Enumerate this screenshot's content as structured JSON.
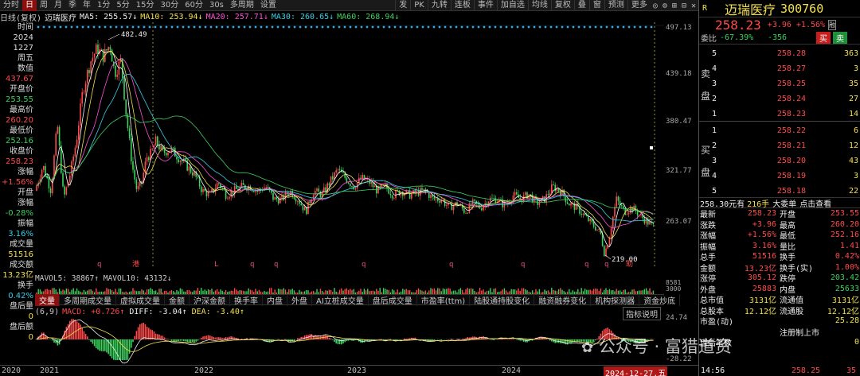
{
  "toolbar": {
    "items": [
      "分时",
      "日",
      "周",
      "月",
      "季",
      "年",
      "1分",
      "5分",
      "15分",
      "30分",
      "60分",
      "30s",
      "多周期",
      "设置"
    ],
    "active_index": 1,
    "right_items": [
      "发",
      "PK",
      "九转",
      "连板",
      "事件",
      "加自选",
      "均线",
      "复权",
      "叠",
      "窗",
      "预测",
      "更多"
    ]
  },
  "subhead": {
    "label": "日线(复权)",
    "name": "迈瑞医疗",
    "ma5": "MA5: 255.57↓",
    "ma10": "MA10: 253.94↓",
    "ma20": "MA20: 257.71↓",
    "ma30": "MA30: 260.65↓",
    "ma60": "MA60: 268.94↓"
  },
  "leftcol": [
    "时间",
    "2024",
    "1227",
    "周五",
    "数值",
    "437.67",
    "开盘价",
    "253.55",
    "最高价",
    "260.20",
    "最低价",
    "252.16",
    "收盘价",
    "258.23",
    "涨幅",
    "+1.56%",
    "开盘",
    "涨幅",
    "-0.28%",
    "振幅",
    "3.16%",
    "成交量",
    "51516",
    "成交额",
    "13.23亿",
    "换手",
    "0.42%",
    "盘后量",
    "0",
    "盘后额",
    "0"
  ],
  "chart": {
    "yticks": [
      "497.13",
      "439.18",
      "380.47",
      "321.77",
      "263.07"
    ],
    "annotations": {
      "high": "482.49",
      "low": "219.00"
    },
    "markers": [
      "q",
      "L",
      "q",
      "q",
      "q",
      "q",
      "q",
      "q",
      "q",
      "q"
    ],
    "special_marker": "港",
    "marker_bottom_right": "助",
    "macd_yticks": [
      "24.74",
      "-28.22"
    ]
  },
  "volume": {
    "label": "MAVOL5: 38867↑  MAVOL10: 43132↓",
    "right_values": [
      "8581",
      "3000"
    ]
  },
  "macd": {
    "label": "(6,9)",
    "macd": "MACD: +0.726↑",
    "diff": "DIFF: -3.04↑",
    "dea": "DEA: -3.40↑",
    "button": "指标说明"
  },
  "tabs": [
    "交量",
    "多周期成交量",
    "虚拟成交量",
    "金额",
    "沪深金额",
    "换手率",
    "内盘",
    "外盘",
    "AI立桩成交量",
    "盘后成交量",
    "市盈率(ttm)",
    "陆股通持股变化",
    "融资融券变化",
    "机构探测器",
    "资金炒底"
  ],
  "tabs_active_index": 0,
  "xaxis": [
    "2020",
    "2021",
    "2022",
    "2023",
    "2024",
    "2024-12-27,五"
  ],
  "right": {
    "badge": "R",
    "stock_name": "迈瑞医疗",
    "stock_code": "300760",
    "price": "258.23",
    "chg": "+3.96",
    "chgpct": "+1.56%",
    "flag": "融",
    "weibi_label": "委比",
    "weibi": "-67.39%",
    "weicha": "-356",
    "buy_btn": "买",
    "sell_btn": "卖",
    "sell_label": [
      "卖",
      "盘"
    ],
    "buy_label": [
      "买",
      "盘"
    ],
    "asks": [
      {
        "lvl": "5",
        "price": "258.28",
        "vol": "363"
      },
      {
        "lvl": "4",
        "price": "258.27",
        "vol": "3"
      },
      {
        "lvl": "3",
        "price": "258.25",
        "vol": "35"
      },
      {
        "lvl": "2",
        "price": "258.24",
        "vol": "27"
      },
      {
        "lvl": "1",
        "price": "258.23",
        "vol": "14"
      }
    ],
    "bids": [
      {
        "lvl": "1",
        "price": "258.22",
        "vol": "6"
      },
      {
        "lvl": "2",
        "price": "258.21",
        "vol": "12"
      },
      {
        "lvl": "3",
        "price": "258.20",
        "vol": "43"
      },
      {
        "lvl": "4",
        "price": "258.19",
        "vol": "3"
      },
      {
        "lvl": "5",
        "price": "258.18",
        "vol": "22"
      }
    ],
    "bigorder": {
      "price": "258.30元有",
      "hands": "216手",
      "big": "大委单",
      "check": "点击查看"
    },
    "stats": [
      {
        "l1": "最新",
        "v1": "258.23",
        "l2": "开盘",
        "v2": "253.55"
      },
      {
        "l1": "涨跌",
        "v1": "+3.96",
        "l2": "最高",
        "v2": "260.20"
      },
      {
        "l1": "涨幅",
        "v1": "+1.56%",
        "l2": "最低",
        "v2": "252.16"
      },
      {
        "l1": "振幅",
        "v1": "3.16%",
        "l2": "量比",
        "v2": "1.41"
      },
      {
        "l1": "总手",
        "v1": "51516",
        "l2": "换手",
        "v2": "0.42%"
      },
      {
        "l1": "金额",
        "v1": "13.23亿",
        "l2": "换手(实)",
        "v2": "1.00%"
      },
      {
        "l1": "涨停",
        "v1": "305.12",
        "l2": "跌停",
        "v2": "203.42"
      },
      {
        "l1": "外盘",
        "v1": "25883",
        "l2": "内盘",
        "v2": "25633"
      },
      {
        "l1": "总市值",
        "v1": "3131亿",
        "l2": "流通值",
        "v2": "3131亿"
      },
      {
        "l1": "总股本",
        "v1": "12.12亿",
        "l2": "流通股",
        "v2": "12.12亿"
      },
      {
        "l1": "市盈(动)",
        "v1": "",
        "l2": "",
        "v2": "25.28"
      },
      {
        "l1": "",
        "v1": "",
        "l2": "注册制上市",
        "v2": ""
      },
      {
        "l1": "盘后笔数",
        "v1": "",
        "l2": "",
        "v2": "0"
      }
    ],
    "bottom": {
      "time": "14:56",
      "price": "258.25",
      "vol": "35"
    }
  },
  "watermark": "公众号 · 富猎道资",
  "colors": {
    "up": "#ff4a4a",
    "down": "#3cd25e",
    "ma5": "#ffffff",
    "ma10": "#f4e04d",
    "ma20": "#ff4fd8",
    "ma30": "#35d0e8",
    "ma60": "#3cd25e"
  }
}
